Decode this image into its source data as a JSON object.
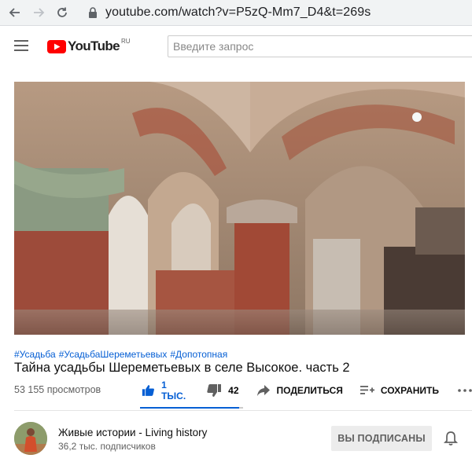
{
  "browser": {
    "url": "youtube.com/watch?v=P5zQ-Mm7_D4&t=269s"
  },
  "header": {
    "logo_text": "YouTube",
    "logo_region": "RU",
    "search_placeholder": "Введите запрос"
  },
  "video": {
    "hashtags": [
      "#Усадьба",
      "#УсадьбаШереметьевых",
      "#Допотопная"
    ],
    "title": "Тайна усадьбы Шереметьевых в селе Высокое. часть 2",
    "views": "53 155 просмотров",
    "likes": "1 ТЫС.",
    "dislikes": "42",
    "share_label": "ПОДЕЛИТЬСЯ",
    "save_label": "СОХРАНИТЬ",
    "like_ratio": 0.96
  },
  "channel": {
    "name": "Живые истории - Living history",
    "subscribers": "36,2 тыс. подписчиков",
    "subscribe_label": "ВЫ ПОДПИСАНЫ"
  },
  "colors": {
    "accent": "#065fd4",
    "brand": "#ff0000"
  }
}
